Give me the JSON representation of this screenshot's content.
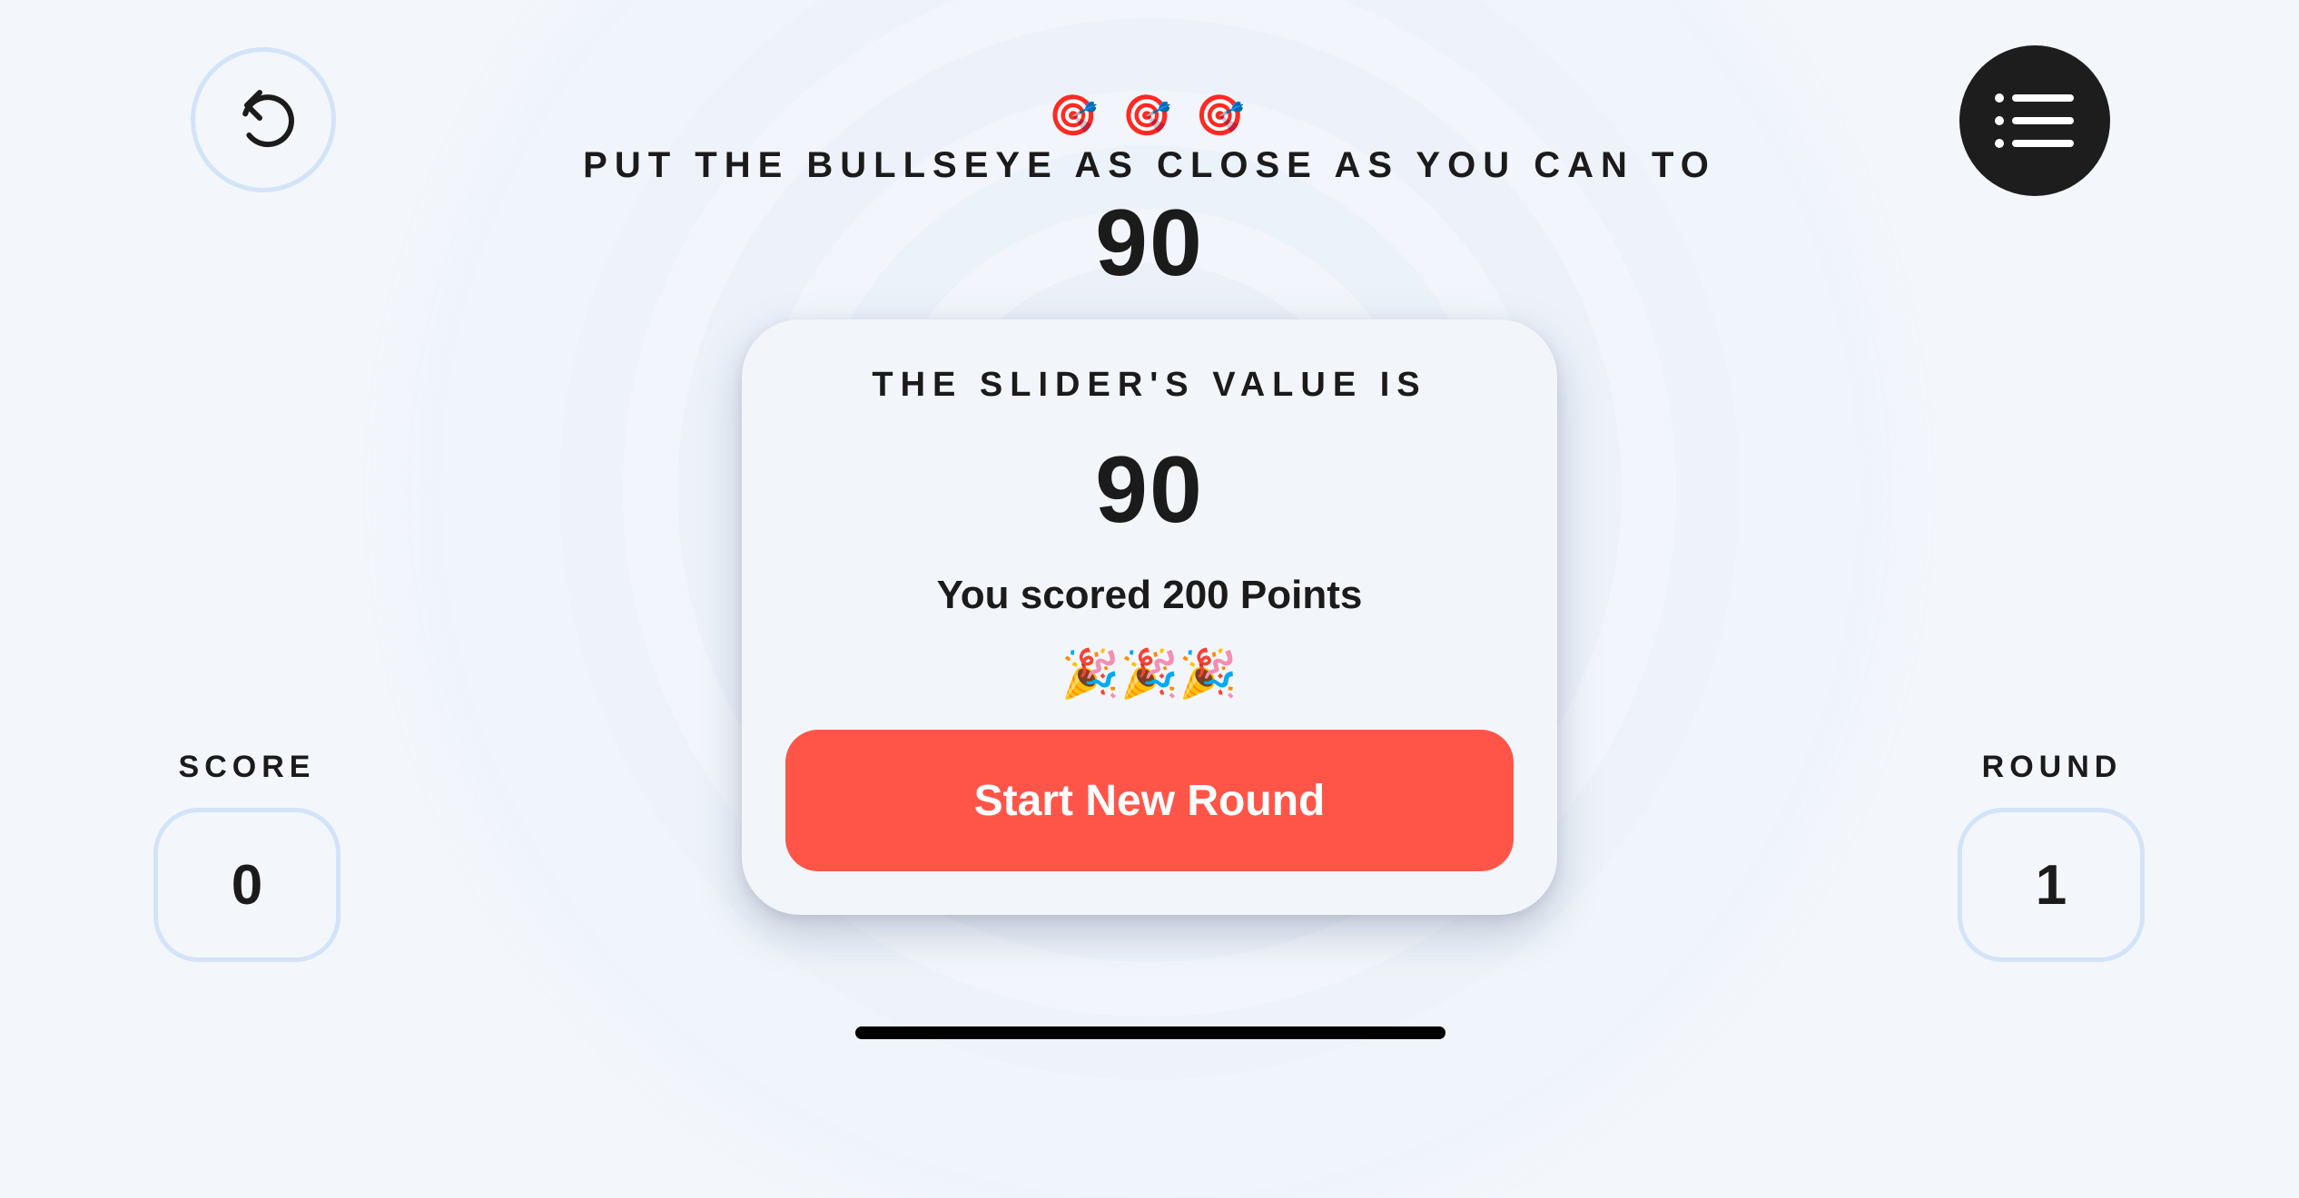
{
  "header": {
    "target_emojis": "🎯 🎯 🎯",
    "instruction": "PUT THE BULLSEYE AS CLOSE AS YOU CAN TO",
    "target_value": "90"
  },
  "controls": {
    "restart_icon": "restart-icon",
    "leaderboard_icon": "list-icon"
  },
  "result_card": {
    "label": "THE SLIDER'S VALUE IS",
    "value": "90",
    "score_text": "You scored 200 Points",
    "celebration_emojis": "🎉🎉🎉",
    "button_label": "Start New Round"
  },
  "stats": {
    "score_label": "SCORE",
    "score_value": "0",
    "round_label": "ROUND",
    "round_value": "1"
  },
  "colors": {
    "background": "#f3f7fc",
    "accent_button": "#ff5549",
    "outline": "#d3e3f8",
    "text": "#1b1b1b",
    "leaderboard_button": "#1d1d1d"
  }
}
